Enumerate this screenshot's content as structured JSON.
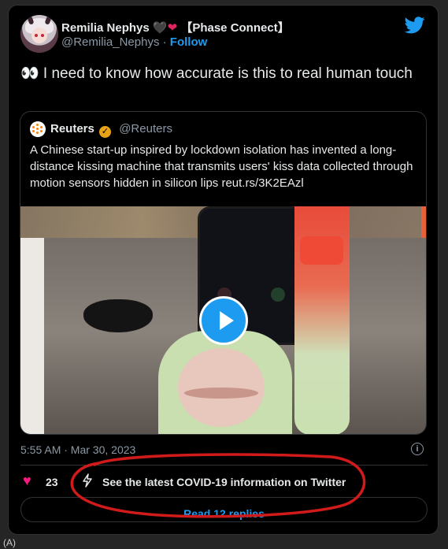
{
  "author": {
    "name": "Remilia Nephys",
    "hearts": [
      "🖤",
      "❤"
    ],
    "affiliation": "【Phase Connect】",
    "handle": "@Remilia_Nephys",
    "separator": "·",
    "follow_label": "Follow"
  },
  "tweet": {
    "text": "👀 I need to know how accurate is this to real human touch"
  },
  "quote": {
    "name": "Reuters",
    "verified_badge": "✓",
    "handle": "@Reuters",
    "text": "A Chinese start-up inspired by lockdown isolation has invented a long-distance kissing machine that transmits users' kiss data collected through motion sensors hidden in silicon lips reut.rs/3K2EAzl"
  },
  "meta": {
    "timestamp": "5:55 AM · Mar 30, 2023",
    "info_icon": "i"
  },
  "actions": {
    "like_count": "23",
    "covid_link": "See the latest COVID-19 information on Twitter",
    "replies_label": "Read 12 replies"
  },
  "caption": "(A)",
  "colors": {
    "accent": "#1d9bf0",
    "like": "#f91880",
    "annotation": "#d11a1a",
    "card_bg": "#000000"
  },
  "icons": {
    "brand": "twitter-bird-icon",
    "like": "heart-icon",
    "covid": "lightning-icon",
    "play": "play-icon",
    "info": "info-icon"
  }
}
